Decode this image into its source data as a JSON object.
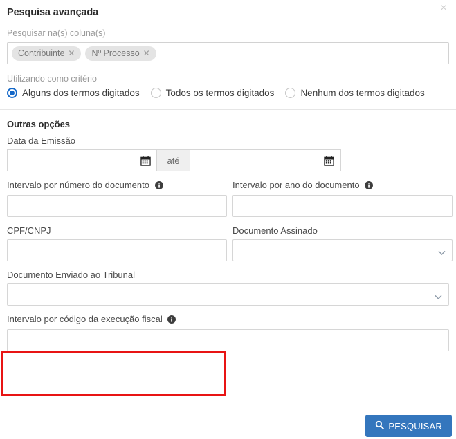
{
  "dialog": {
    "title": "Pesquisa avançada",
    "close_icon": "close-icon",
    "close_label": "×"
  },
  "columns_search": {
    "label": "Pesquisar na(s) coluna(s)",
    "tokens": [
      {
        "label": "Contribuinte",
        "remove_label": "✕"
      },
      {
        "label": "Nº Processo",
        "remove_label": "✕"
      }
    ]
  },
  "criteria": {
    "label": "Utilizando como critério",
    "options": [
      {
        "label": "Alguns dos termos digitados",
        "selected": true
      },
      {
        "label": "Todos os termos digitados",
        "selected": false
      },
      {
        "label": "Nenhum dos termos digitados",
        "selected": false
      }
    ]
  },
  "other_options": {
    "section_title": "Outras opções",
    "emission_date": {
      "label": "Data da Emissão",
      "start_value": "",
      "start_placeholder": "",
      "separator_label": "até",
      "end_value": "",
      "end_placeholder": "",
      "calendar_icon": "calendar-icon"
    },
    "doc_number_range": {
      "label": "Intervalo por número do documento",
      "info_icon": "info-icon",
      "value": "",
      "placeholder": ""
    },
    "doc_year_range": {
      "label": "Intervalo por ano do documento",
      "info_icon": "info-icon",
      "value": "",
      "placeholder": ""
    },
    "cpf_cnpj": {
      "label": "CPF/CNPJ",
      "value": "",
      "placeholder": ""
    },
    "signed_document": {
      "label": "Documento Assinado",
      "selected_value": "",
      "chevron_icon": "chevron-down-icon"
    },
    "document_sent_to_court": {
      "label": "Documento Enviado ao Tribunal",
      "selected_value": "",
      "chevron_icon": "chevron-down-icon"
    },
    "fiscal_execution_code_range": {
      "label": "Intervalo por código da execução fiscal",
      "info_icon": "info-icon",
      "value": "",
      "placeholder": "",
      "highlight_color": "#e81414"
    }
  },
  "footer": {
    "search_button_label": "PESQUISAR",
    "search_icon": "search-icon",
    "accent_color": "#3476bd"
  }
}
